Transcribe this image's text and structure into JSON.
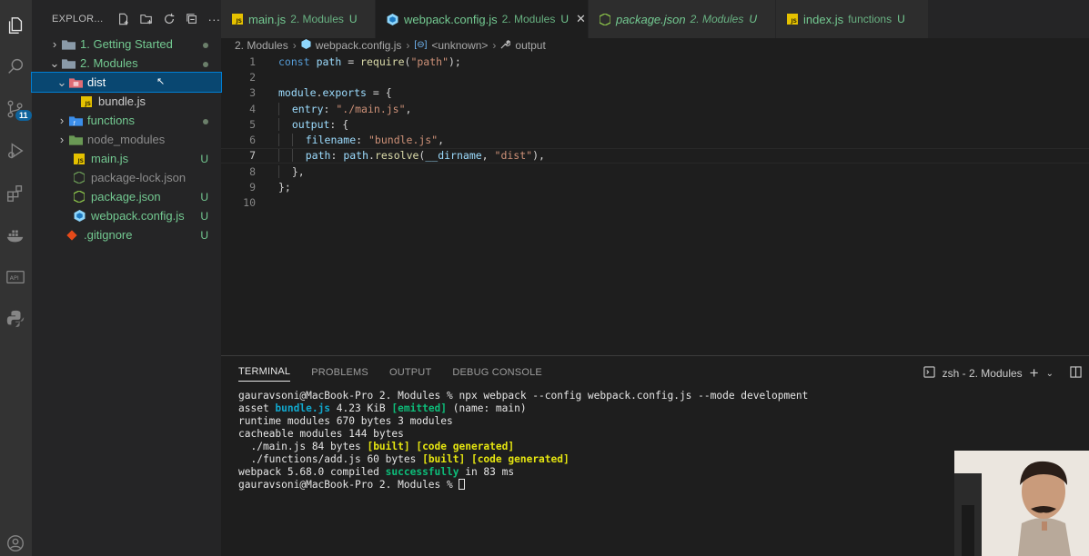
{
  "activity_bar": {
    "icons": [
      "files-icon",
      "search-icon",
      "source-control-icon",
      "run-debug-icon",
      "extensions-icon",
      "docker-icon",
      "api-icon",
      "python-icon",
      "account-icon"
    ],
    "scm_badge": "11"
  },
  "explorer": {
    "title": "EXPLOR...",
    "tree": [
      {
        "label": "1. Getting Started",
        "status": "dot"
      },
      {
        "label": "2. Modules",
        "status": "dot"
      },
      {
        "label": "dist",
        "status": ""
      },
      {
        "label": "bundle.js",
        "status": ""
      },
      {
        "label": "functions",
        "status": "dot"
      },
      {
        "label": "node_modules",
        "status": ""
      },
      {
        "label": "main.js",
        "status": "U"
      },
      {
        "label": "package-lock.json",
        "status": ""
      },
      {
        "label": "package.json",
        "status": "U"
      },
      {
        "label": "webpack.config.js",
        "status": "U"
      },
      {
        "label": ".gitignore",
        "status": "U"
      }
    ]
  },
  "tabs": [
    {
      "name": "main.js",
      "desc": "2. Modules",
      "status": "U"
    },
    {
      "name": "webpack.config.js",
      "desc": "2. Modules",
      "status": "U",
      "close": "✕"
    },
    {
      "name": "package.json",
      "desc": "2. Modules",
      "status": "U"
    },
    {
      "name": "index.js",
      "desc": "functions",
      "status": "U"
    }
  ],
  "breadcrumb": [
    "2. Modules",
    "webpack.config.js",
    "<unknown>",
    "output"
  ],
  "code": {
    "line_numbers": [
      "1",
      "2",
      "3",
      "4",
      "5",
      "6",
      "7",
      "8",
      "9",
      "10"
    ],
    "current_line": 7
  },
  "panel": {
    "tabs": [
      "TERMINAL",
      "PROBLEMS",
      "OUTPUT",
      "DEBUG CONSOLE"
    ],
    "terminal_name": "zsh - 2. Modules",
    "terminal_lines": {
      "l1": "gauravsoni@MacBook-Pro 2. Modules % npx webpack --config webpack.config.js --mode development",
      "l2a": "asset ",
      "l2b": "bundle.js",
      "l2c": " 4.23 KiB ",
      "l2d": "[emitted]",
      "l2e": " (name: main)",
      "l3": "runtime modules 670 bytes 3 modules",
      "l4": "cacheable modules 144 bytes",
      "l5a": "  ./main.js 84 bytes ",
      "l5b": "[built] [code generated]",
      "l6a": "  ./functions/add.js 60 bytes ",
      "l6b": "[built] [code generated]",
      "l7a": "webpack 5.68.0 compiled ",
      "l7b": "successfully",
      "l7c": " in 83 ms",
      "l8": "gauravsoni@MacBook-Pro 2. Modules % "
    }
  }
}
